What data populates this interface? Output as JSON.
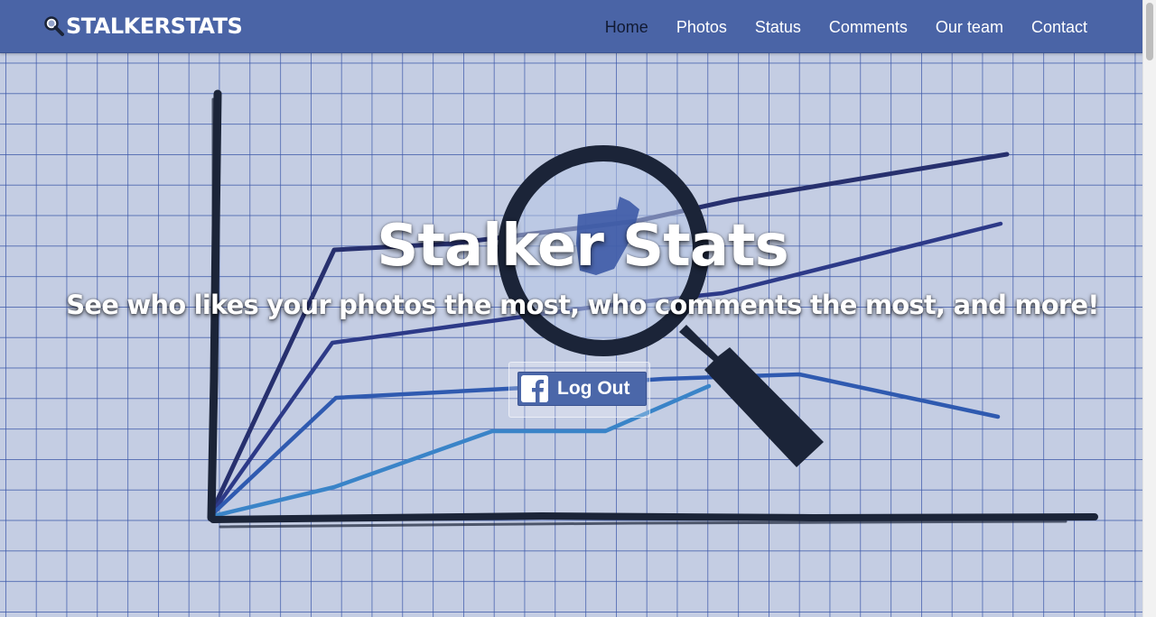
{
  "brand": {
    "name": "STALKERSTATS",
    "icon": "magnifier-icon"
  },
  "nav": {
    "items": [
      {
        "label": "Home",
        "active": true
      },
      {
        "label": "Photos",
        "active": false
      },
      {
        "label": "Status",
        "active": false
      },
      {
        "label": "Comments",
        "active": false
      },
      {
        "label": "Our team",
        "active": false
      },
      {
        "label": "Contact",
        "active": false
      }
    ]
  },
  "hero": {
    "title": "Stalker Stats",
    "subtitle": "See who likes your photos the most, who comments the most, and more!",
    "login_button": {
      "label": "Log Out",
      "icon": "facebook-icon"
    }
  },
  "colors": {
    "navbar": "#4a64a6",
    "grid_background": "#c4cde3",
    "grid_lines": "#3a56a8",
    "dark_ink": "#1b2438",
    "facebook_blue": "#4b67a9"
  }
}
